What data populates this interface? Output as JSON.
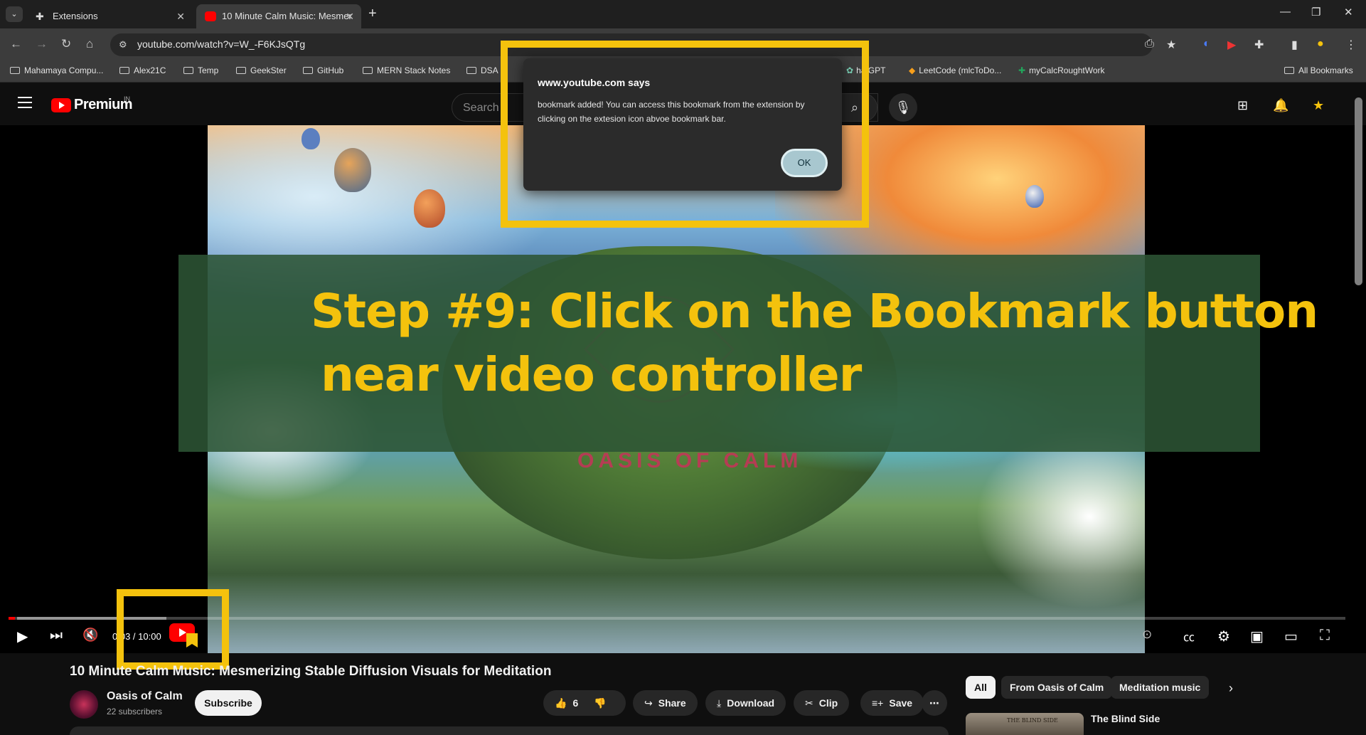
{
  "browser": {
    "tab_search_glyph": "⌄",
    "tabs": [
      {
        "title": "Extensions",
        "close": "✕"
      },
      {
        "title": "10 Minute Calm Music: Mesmer",
        "close": "✕"
      }
    ],
    "new_tab": "+",
    "window_controls": {
      "minimize": "—",
      "restore": "❐",
      "close": "✕"
    },
    "url": "youtube.com/watch?v=W_-F6KJsQTg",
    "bookmarks": [
      "Mahamaya Compu...",
      "Alex21C",
      "Temp",
      "GeekSter",
      "GitHub",
      "MERN Stack Notes",
      "DSA",
      "hatGPT",
      "LeetCode (mlcToDo...",
      "myCalcRoughtWork"
    ],
    "all_bookmarks": "All Bookmarks"
  },
  "masthead": {
    "logo_text": "Premium",
    "country": "IN",
    "search_placeholder": "Search"
  },
  "dialog": {
    "title": "www.youtube.com says",
    "message": "bookmark added! You can access this bookmark from the extension by clicking on the extesion icon abvoe bookmark bar.",
    "ok_label": "OK"
  },
  "overlay": {
    "line1": "Step #9: Click on the Bookmark button",
    "line2": "near video controller"
  },
  "video": {
    "watermark": "OASIS OF CALM",
    "time_display": "0:03 / 10:00",
    "progress_fraction": 0.005
  },
  "watch": {
    "title": "10 Minute Calm Music: Mesmerizing Stable Diffusion Visuals for Meditation",
    "channel_name": "Oasis of Calm",
    "subscribers": "22 subscribers",
    "subscribe_label": "Subscribe",
    "like_count": "6",
    "share_label": "Share",
    "download_label": "Download",
    "clip_label": "Clip",
    "save_label": "Save"
  },
  "chips": [
    "All",
    "From Oasis of Calm",
    "Meditation music"
  ],
  "recommendation": {
    "title": "The Blind Side",
    "thumb_text": "THE BLIND SIDE"
  },
  "colors": {
    "highlight": "#f4c20d",
    "youtube_red": "#ff0000",
    "banner": "#2c5434"
  }
}
